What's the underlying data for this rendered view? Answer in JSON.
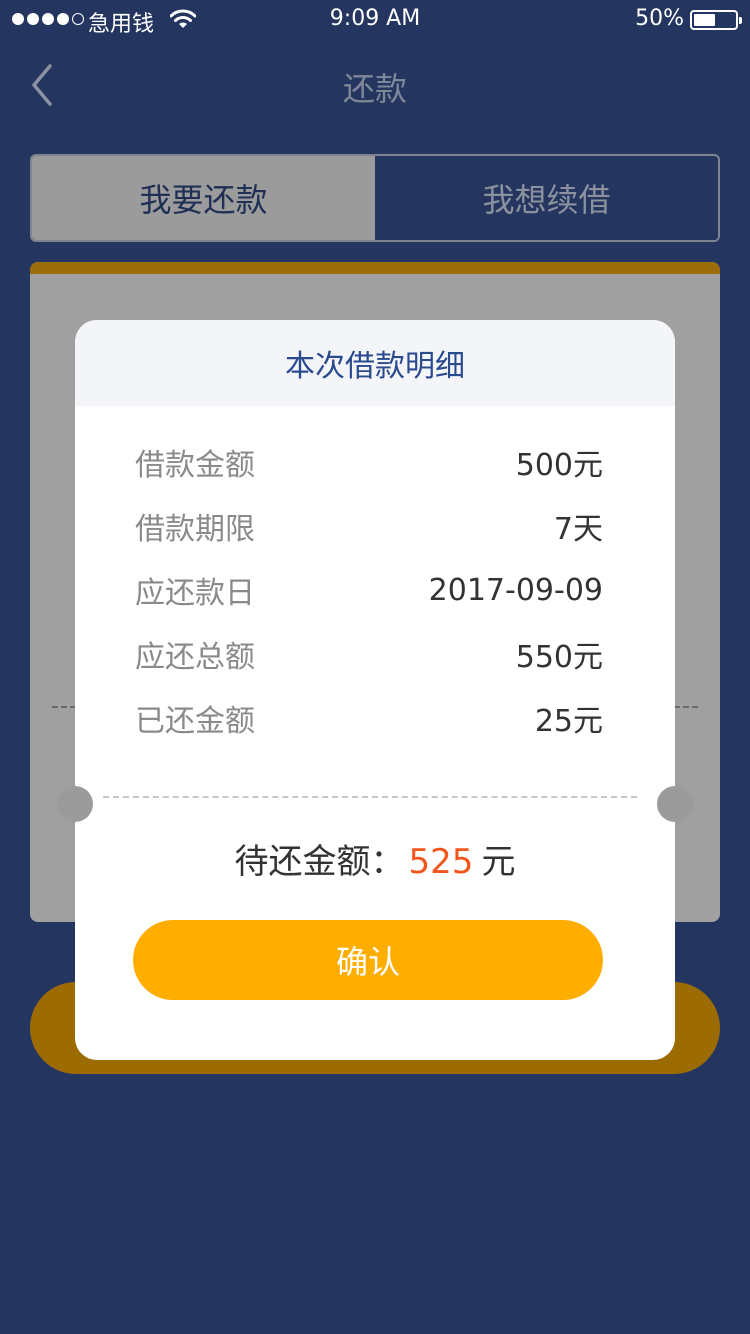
{
  "status_bar": {
    "carrier": "急用钱",
    "time": "9:09 AM",
    "battery": "50%",
    "battery_level": 0.5,
    "signal_bars": 4,
    "signal_total": 5
  },
  "nav": {
    "title": "还款",
    "back_icon": "chevron-left-icon"
  },
  "tabs": [
    {
      "label": "我要还款",
      "active": true
    },
    {
      "label": "我想续借",
      "active": false
    }
  ],
  "modal": {
    "title": "本次借款明细",
    "rows": [
      {
        "label": "借款金额",
        "value": "500元"
      },
      {
        "label": "借款期限",
        "value": "7天"
      },
      {
        "label": "应还款日",
        "value": "2017-09-09"
      },
      {
        "label": "应还总额",
        "value": "550元"
      },
      {
        "label": "已还金额",
        "value": "25元"
      }
    ],
    "due_label": "待还金额：",
    "due_amount": "525",
    "due_unit": "元",
    "confirm_label": "确认"
  },
  "colors": {
    "background": "#243660",
    "accent": "#ffae00",
    "amount": "#f2561d",
    "modal_title": "#2a4a8e"
  }
}
